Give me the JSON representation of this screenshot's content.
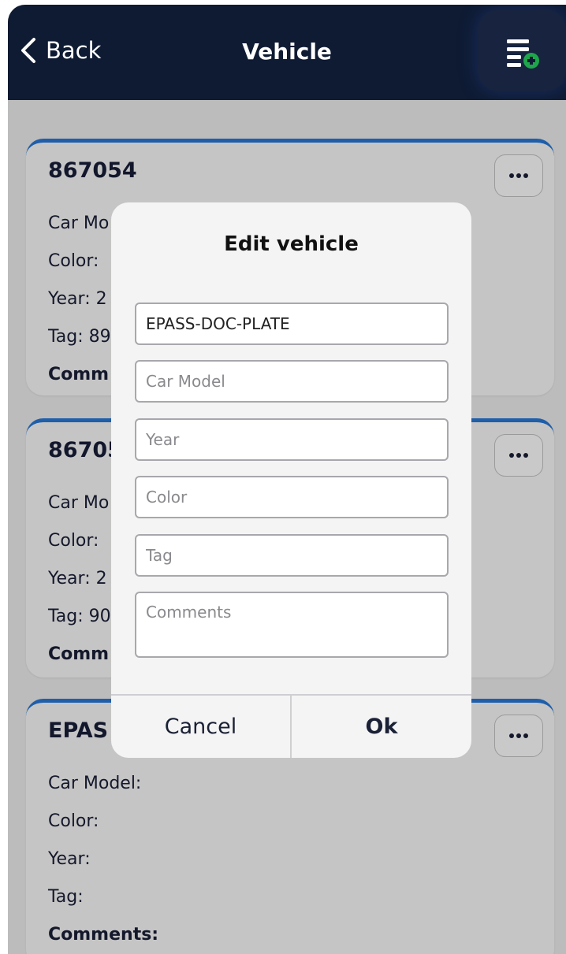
{
  "header": {
    "back_label": "Back",
    "title": "Vehicle",
    "add_icon": "list-add-icon",
    "colors": {
      "background": "#0f1b33",
      "add_badge": "#1ea64a"
    }
  },
  "cards": [
    {
      "title": "867054",
      "car_model_label": "Car Mo",
      "color_label": "Color: ",
      "year_label": "Year: 2",
      "tag_label": "Tag: 89",
      "comments_label": "Comm"
    },
    {
      "title": "86705",
      "car_model_label": "Car Mo",
      "color_label": "Color: ",
      "year_label": "Year: 2",
      "tag_label": "Tag: 90",
      "comments_label": "Comm"
    },
    {
      "title": "EPAS",
      "car_model_label": "Car Model:",
      "color_label": "Color:",
      "year_label": "Year:",
      "tag_label": "Tag:",
      "comments_label": "Comments:"
    }
  ],
  "card_accent": "#1f5ea9",
  "modal": {
    "title": "Edit vehicle",
    "plate_value": "EPASS-DOC-PLATE",
    "car_model_placeholder": "Car Model",
    "year_placeholder": "Year",
    "color_placeholder": "Color",
    "tag_placeholder": "Tag",
    "comments_placeholder": "Comments",
    "cancel_label": "Cancel",
    "ok_label": "Ok"
  }
}
